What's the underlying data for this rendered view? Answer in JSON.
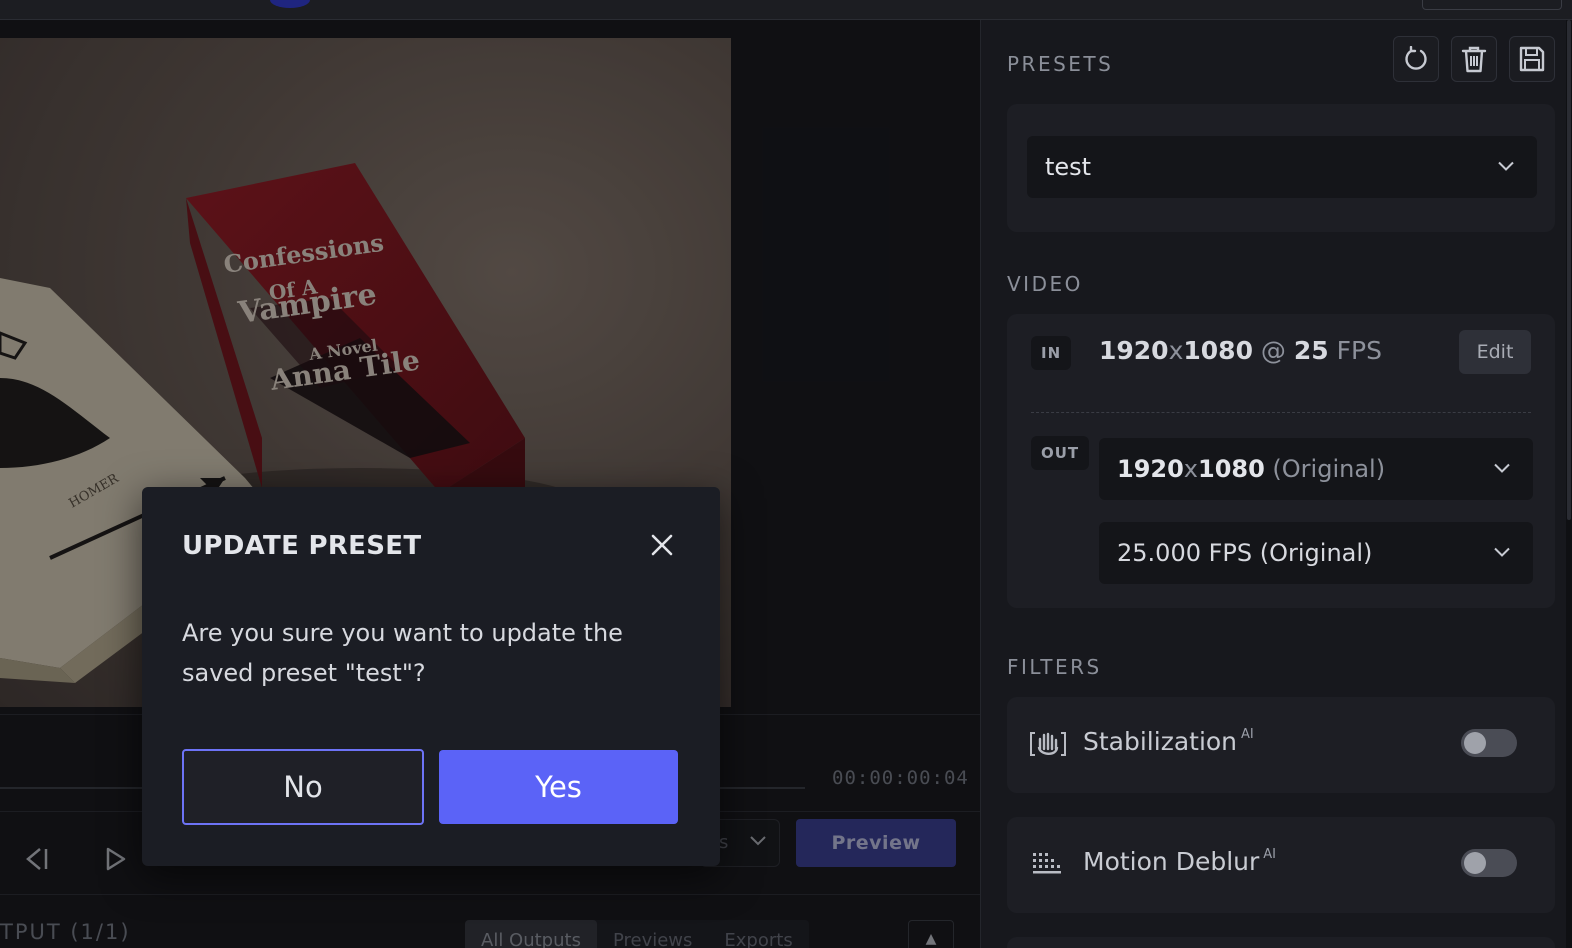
{
  "presets": {
    "title": "PRESETS",
    "selected": "test",
    "icons": [
      "reset-icon",
      "trash-icon",
      "save-icon"
    ]
  },
  "video": {
    "title": "VIDEO",
    "in_tag": "IN",
    "in_width": "1920",
    "in_x": "x",
    "in_height": "1080",
    "in_at": " @ ",
    "in_fps": "25",
    "in_fps_unit": " FPS",
    "edit_label": "Edit",
    "out_tag": "OUT",
    "out_res_bold": "1920",
    "out_res_x": "x",
    "out_res_bold2": "1080",
    "out_res_suffix": " (Original)",
    "out_fps": "25.000 FPS (Original)"
  },
  "filters": {
    "title": "FILTERS",
    "items": [
      {
        "label": "Stabilization",
        "badge": "AI",
        "enabled": false,
        "icon": "stabilization-icon"
      },
      {
        "label": "Motion Deblur",
        "badge": "AI",
        "enabled": false,
        "icon": "deblur-icon"
      }
    ]
  },
  "player": {
    "timecode": "00:00:00:04",
    "quality_partial": "s",
    "preview_label": "Preview"
  },
  "output": {
    "title": "TPUT (1/1)",
    "tabs": [
      "All Outputs",
      "Previews",
      "Exports"
    ],
    "active_tab": "All Outputs"
  },
  "dialog": {
    "title": "UPDATE PRESET",
    "message": "Are you sure you want to update the saved preset \"test\"?",
    "no_label": "No",
    "yes_label": "Yes"
  },
  "colors": {
    "accent": "#5b63f7",
    "panel": "#1d1e24",
    "background": "#141519"
  }
}
